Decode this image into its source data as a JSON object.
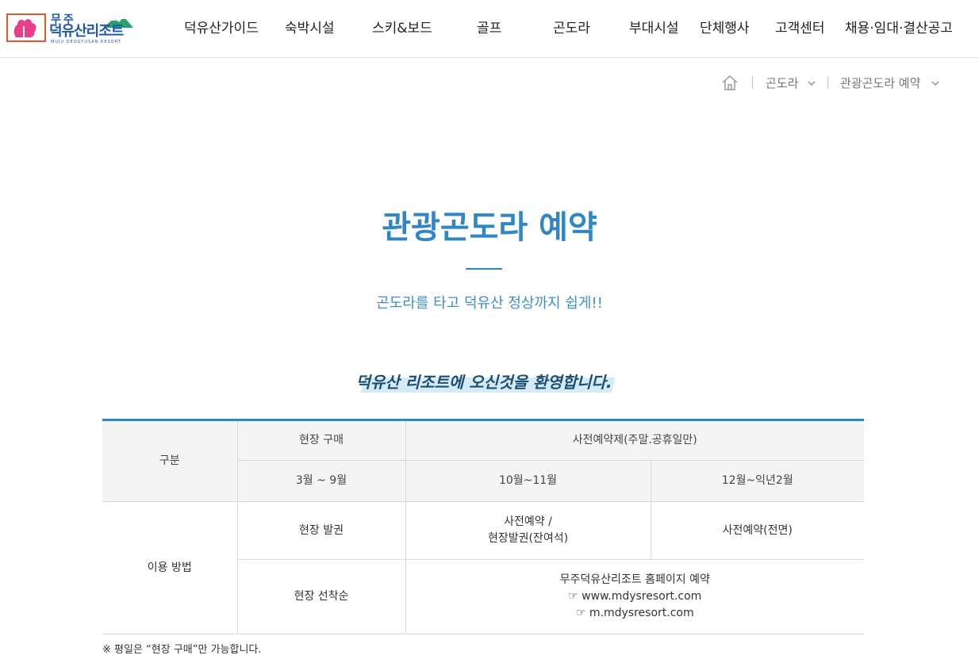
{
  "header": {
    "logo": {
      "line1": "무주",
      "line2": "덕유산리조트",
      "line3": "MUJU DEOGYUSAN RESORT"
    },
    "nav": [
      "덕유산가이드",
      "숙박시설",
      "스키&보드",
      "골프",
      "곤도라",
      "부대시설",
      "단체행사",
      "고객센터",
      "채용·임대·결산공고"
    ]
  },
  "breadcrumb": {
    "level1": "곤도라",
    "level2": "관광곤도라 예약"
  },
  "page": {
    "title": "관광곤도라 예약",
    "subtitle": "곤도라를 타고 덕유산 정상까지 쉽게!!",
    "welcome": "덕유산 리조트에 오신것을 환영합니다."
  },
  "table": {
    "header_category": "구분",
    "header_onsite": "현장 구매",
    "header_reservation": "사전예약제(주말.공휴일만)",
    "period_1": "3월 ~ 9월",
    "period_2": "10월~11월",
    "period_3": "12월~익년2월",
    "row_label": "이용 방법",
    "r1_c1": "현장 발권",
    "r1_c2_line1": "사전예약 /",
    "r1_c2_line2": "현장발권(잔여석)",
    "r1_c3": "사전예약(전면)",
    "r2_c1": "현장 선착순",
    "r2_c2_line1": "무주덕유산리조트 홈페이지 예약",
    "r2_c2_line2": "☞ www.mdysresort.com",
    "r2_c2_line3": "☞ m.mdysresort.com"
  },
  "note": "※ 평일은 “현장 구매”만 가능합니다.",
  "colors": {
    "accent": "#2f87c6",
    "logo_blue": "#1f5aa6",
    "logo_orange": "#e2582f",
    "logo_pink": "#e83e8c"
  },
  "icons": {
    "home": "home-icon",
    "dropdown": "chevron-down-icon"
  }
}
